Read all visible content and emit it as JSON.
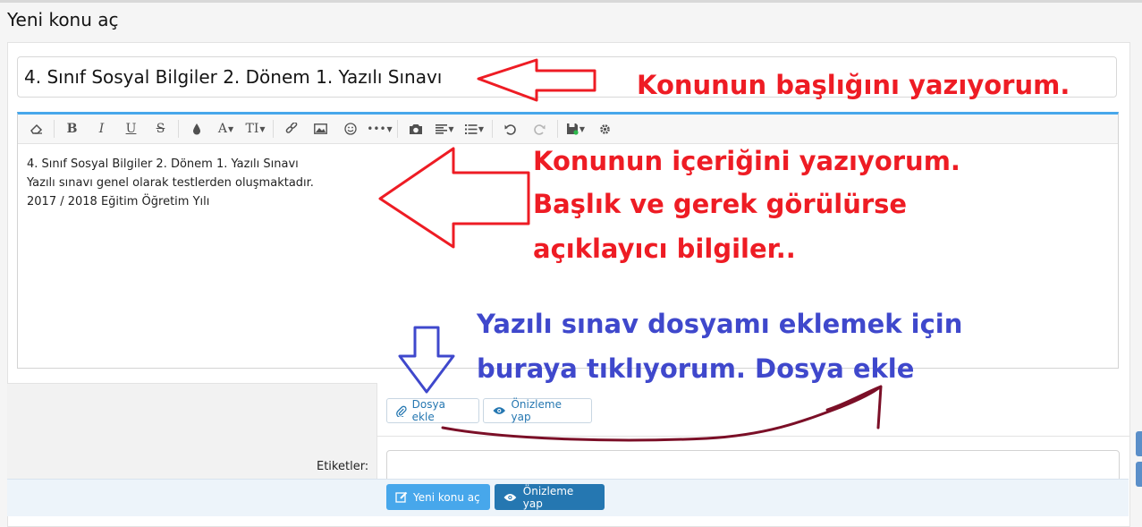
{
  "page_title": "Yeni konu aç",
  "title_field": {
    "value": "4. Sınıf Sosyal Bilgiler 2. Dönem 1. Yazılı Sınavı"
  },
  "editor": {
    "lines": [
      "4. Sınıf Sosyal Bilgiler 2. Dönem 1. Yazılı Sınavı",
      "Yazılı sınavı genel olarak testlerden oluşmaktadır.",
      "2017 / 2018 Eğitim Öğretim Yılı"
    ],
    "toolbar": {
      "bold": "B",
      "italic": "I",
      "underline": "U",
      "strike": "S",
      "font_size": "A",
      "text_style": "TI"
    }
  },
  "attachments": {
    "attach_label": "Dosya ekle",
    "preview_label": "Önizleme yap"
  },
  "tags": {
    "label": "Etiketler:"
  },
  "footer": {
    "submit_label": "Yeni konu aç",
    "preview_label": "Önizleme yap"
  },
  "annotations": {
    "title_note": "Konunun başlığını yazıyorum.",
    "content_note": [
      "Konunun içeriğini yazıyorum.",
      "Başlık ve gerek görülürse",
      "açıklayıcı bilgiler.."
    ],
    "upload_note": [
      "Yazılı sınav dosyamı eklemek için",
      "buraya tıklıyorum. Dosya ekle"
    ]
  },
  "colors": {
    "accent": "#47a7eb",
    "annotation_red": "#ee1c24",
    "annotation_blue": "#3f48cc",
    "annotation_curve": "#7b0f27",
    "primary_button": "#47a7eb",
    "secondary_button": "#2577b1"
  },
  "icons": {
    "eraser": "eraser-icon",
    "paperclip": "paperclip-icon",
    "eye": "eye-icon",
    "pencil": "pencil-icon",
    "camera": "camera-icon",
    "link": "link-icon",
    "image": "image-icon",
    "smiley": "smiley-icon",
    "undo": "undo-icon",
    "redo": "redo-icon",
    "save": "save-icon",
    "gear": "gear-icon"
  }
}
